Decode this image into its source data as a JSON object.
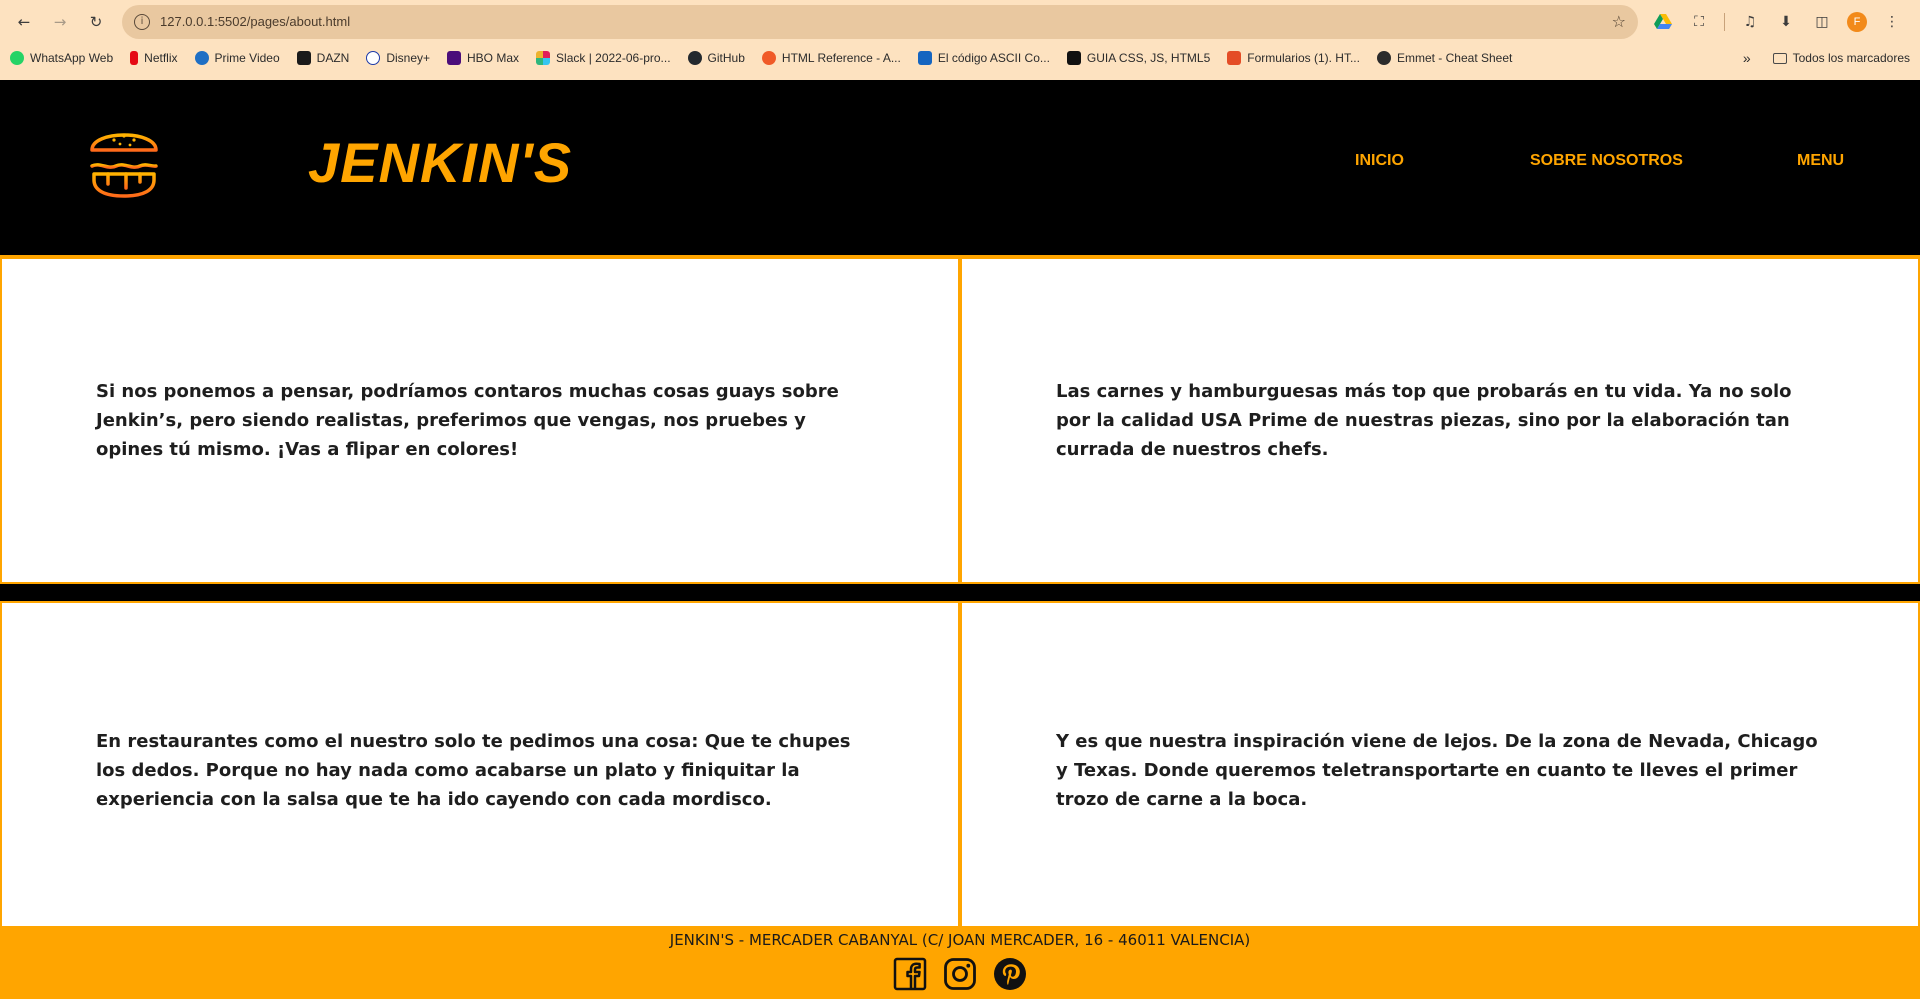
{
  "browser": {
    "url": "127.0.0.1:5502/pages/about.html",
    "profile_initial": "F",
    "bookmarks": [
      {
        "label": "WhatsApp Web",
        "color": "#25d366"
      },
      {
        "label": "Netflix",
        "color": "#e50914"
      },
      {
        "label": "Prime Video",
        "color": "#1f6fc4"
      },
      {
        "label": "DAZN",
        "color": "#1a1a1a"
      },
      {
        "label": "Disney+",
        "color": "#1c3aa9"
      },
      {
        "label": "HBO Max",
        "color": "#4b0d7a"
      },
      {
        "label": "Slack | 2022-06-pro...",
        "color": "#e01e5a"
      },
      {
        "label": "GitHub",
        "color": "#24292e"
      },
      {
        "label": "HTML Reference - A...",
        "color": "#f05a28"
      },
      {
        "label": "El código ASCII Co...",
        "color": "#1565c0"
      },
      {
        "label": "GUIA CSS, JS, HTML5",
        "color": "#111111"
      },
      {
        "label": "Formularios (1). HT...",
        "color": "#e44d26"
      },
      {
        "label": "Emmet - Cheat Sheet",
        "color": "#2b2b2b"
      }
    ],
    "all_bookmarks": "Todos los marcadores"
  },
  "site": {
    "brand": "JENKIN'S",
    "nav": {
      "inicio": "Inicio",
      "sobre": "Sobre nosotros",
      "menu": "Menu"
    },
    "cards": [
      "Si nos ponemos a pensar, podríamos contaros muchas cosas guays sobre Jenkin’s, pero siendo realistas, preferimos que vengas, nos pruebes y opines tú mismo. ¡Vas a flipar en colores!",
      "Las carnes y hamburguesas más top que probarás en tu vida. Ya no solo por la calidad USA Prime de nuestras piezas, sino por la elaboración tan currada de nuestros chefs.",
      "En restaurantes como el nuestro solo te pedimos una cosa: Que te chupes los dedos. Porque no hay nada como acabarse un plato y finiquitar la experiencia con la salsa que te ha ido cayendo con cada mordisco.",
      "Y es que nuestra inspiración viene de lejos. De la zona de Nevada, Chicago y Texas. Donde queremos teletransportarte en cuanto te lleves el primer trozo de carne a la boca."
    ],
    "footer_address": "Jenkin's - Mercader Cabanyal (C/ Joan Mercader, 16 - 46011 Valencia)",
    "social": [
      "facebook-icon",
      "instagram-icon",
      "pinterest-icon"
    ],
    "accent_color": "#ffa500"
  }
}
